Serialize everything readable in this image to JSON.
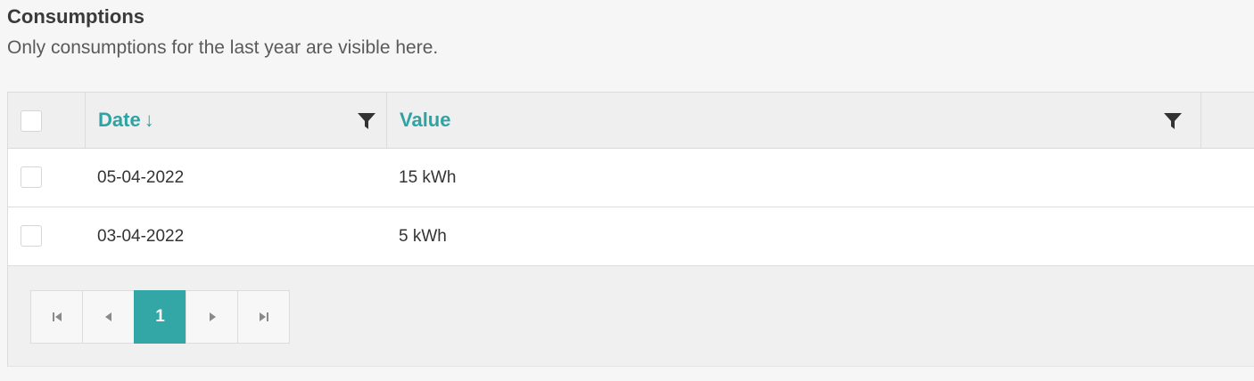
{
  "section": {
    "title": "Consumptions",
    "subtitle": "Only consumptions for the last year are visible here."
  },
  "table": {
    "columns": [
      {
        "label": "Date",
        "sort_indicator": "↓",
        "filterable": true
      },
      {
        "label": "Value",
        "filterable": true
      }
    ],
    "rows": [
      {
        "date": "05-04-2022",
        "value": "15 kWh"
      },
      {
        "date": "03-04-2022",
        "value": "5 kWh"
      }
    ]
  },
  "pagination": {
    "current_page": "1",
    "first_icon": "first-page-icon",
    "prev_icon": "previous-page-icon",
    "next_icon": "next-page-icon",
    "last_icon": "last-page-icon"
  },
  "colors": {
    "accent": "#32a7a5",
    "header_text": "#2ea3a3"
  }
}
